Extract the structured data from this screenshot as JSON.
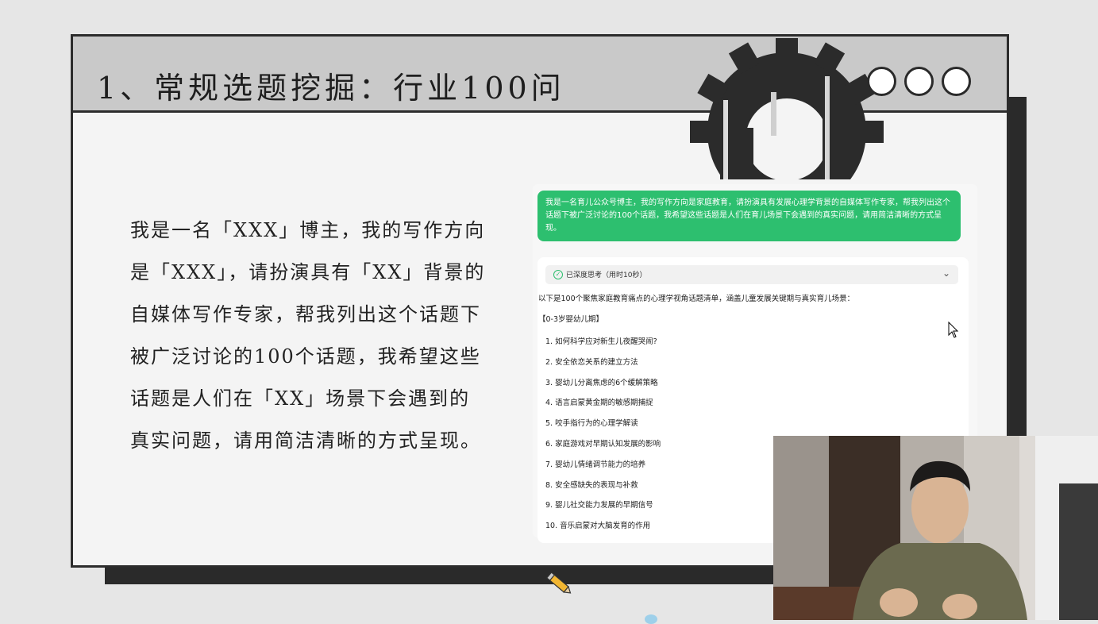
{
  "slide": {
    "title": "1、常规选题挖掘：行业100问",
    "prompt_text": "我是一名「XXX」博主，我的写作方向是「XXX」，请扮演具有「XX」背景的自媒体写作专家，帮我列出这个话题下被广泛讨论的100个话题，我希望这些话题是人们在「XX」场景下会遇到的真实问题，请用简洁清晰的方式呈现。"
  },
  "chat": {
    "user_message": "我是一名育儿公众号博主，我的写作方向是家庭教育，请扮演具有发展心理学背景的自媒体写作专家，帮我列出这个话题下被广泛讨论的100个话题，我希望这些话题是人们在育儿场景下会遇到的真实问题，请用简洁清晰的方式呈现。",
    "thinking_label": "已深度思考（用时10秒）",
    "intro": "以下是100个聚焦家庭教育痛点的心理学视角话题清单，涵盖儿童发展关键期与真实育儿场景：",
    "section_title": "【0-3岁婴幼儿期】",
    "topics": [
      "1. 如何科学应对新生儿夜醒哭闹?",
      "2. 安全依恋关系的建立方法",
      "3. 婴幼儿分离焦虑的6个缓解策略",
      "4. 语言启蒙黄金期的敏感期捕捉",
      "5. 咬手指行为的心理学解读",
      "6. 家庭游戏对早期认知发展的影响",
      "7. 婴幼儿情绪调节能力的培养",
      "8. 安全感缺失的表现与补救",
      "9. 婴儿社交能力发展的早期信号",
      "10. 音乐启蒙对大脑发育的作用"
    ]
  },
  "colors": {
    "accent_green": "#2dbf6f",
    "slide_border": "#2c2c2c",
    "title_bar_bg": "#c9c9c9"
  },
  "icons": {
    "thinking_status": "check-circle-icon",
    "expand": "chevron-down-icon",
    "pointer": "mouse-cursor-icon"
  }
}
